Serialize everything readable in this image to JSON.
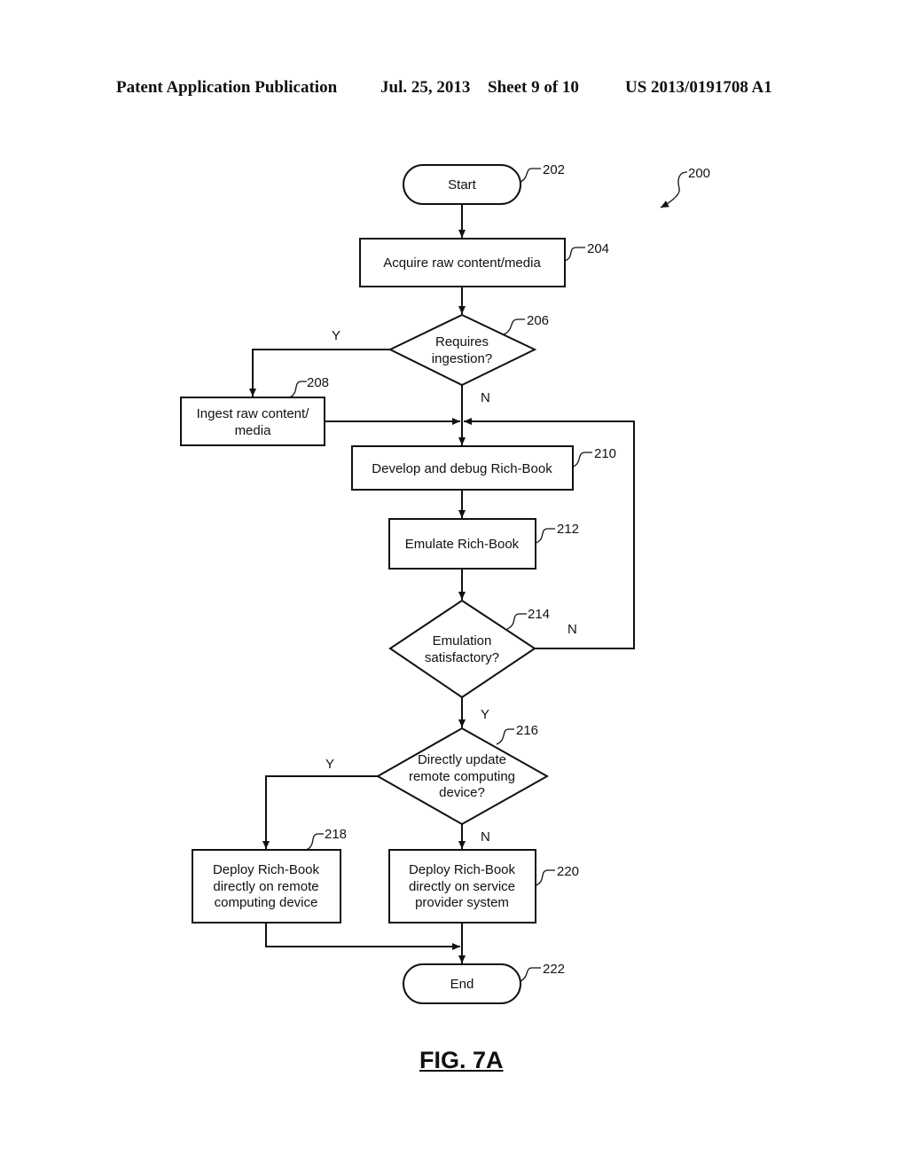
{
  "header": {
    "left": "Patent Application Publication",
    "date": "Jul. 25, 2013",
    "sheet": "Sheet 9 of 10",
    "number": "US 2013/0191708 A1"
  },
  "diagram": {
    "ref_overall": "200",
    "nodes": {
      "start": {
        "ref": "202",
        "lines": [
          "Start"
        ]
      },
      "acquire": {
        "ref": "204",
        "lines": [
          "Acquire raw content/media"
        ]
      },
      "requires": {
        "ref": "206",
        "lines": [
          "Requires",
          "ingestion?"
        ]
      },
      "ingest": {
        "ref": "208",
        "lines": [
          "Ingest raw content/",
          "media"
        ]
      },
      "develop": {
        "ref": "210",
        "lines": [
          "Develop and debug Rich-Book"
        ]
      },
      "emulate": {
        "ref": "212",
        "lines": [
          "Emulate Rich-Book"
        ]
      },
      "satisfactory": {
        "ref": "214",
        "lines": [
          "Emulation",
          "satisfactory?"
        ]
      },
      "directly": {
        "ref": "216",
        "lines": [
          "Directly update",
          "remote computing",
          "device?"
        ]
      },
      "deploy_remote": {
        "ref": "218",
        "lines": [
          "Deploy Rich-Book",
          "directly on remote",
          "computing device"
        ]
      },
      "deploy_provider": {
        "ref": "220",
        "lines": [
          "Deploy Rich-Book",
          "directly on service",
          "provider system"
        ]
      },
      "end": {
        "ref": "222",
        "lines": [
          "End"
        ]
      }
    },
    "branch_labels": {
      "requires_yes": "Y",
      "requires_no": "N",
      "satisfactory_no": "N",
      "satisfactory_yes": "Y",
      "directly_yes": "Y",
      "directly_no": "N"
    }
  },
  "figure_label": "FIG. 7A"
}
